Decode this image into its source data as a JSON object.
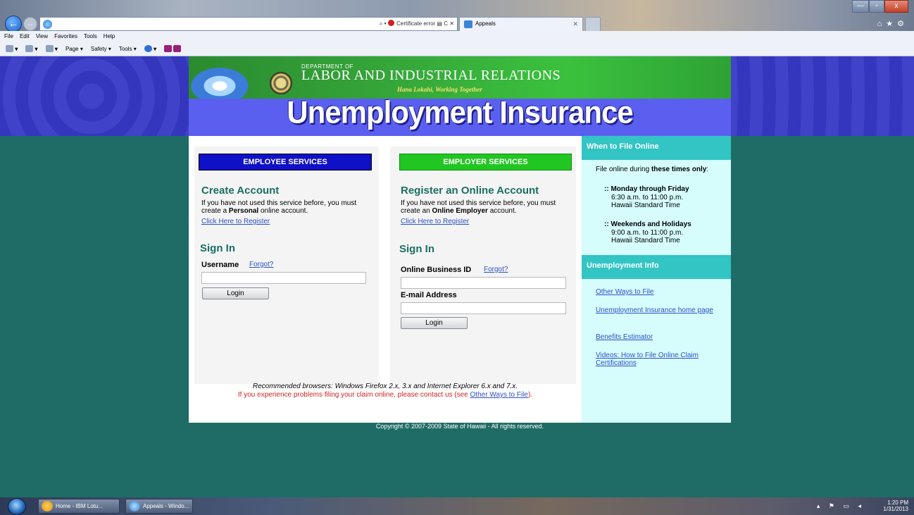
{
  "browser": {
    "address_text": "",
    "cert_error": "Certificate error",
    "addr_controls": "⌕ ▾",
    "addr_refresh": "▤ C ✕",
    "tab_title": "Appeals",
    "tab_close": "✕",
    "back_glyph": "←",
    "forward_glyph": "→",
    "min_glyph": "—",
    "max_glyph": "▫",
    "close_glyph": "x",
    "right_icons": "⌂★⚙",
    "menu": [
      "File",
      "Edit",
      "View",
      "Favorites",
      "Tools",
      "Help"
    ],
    "commands": [
      "▾",
      "▾",
      "▾",
      "Page ▾",
      "Safety ▾",
      "Tools ▾",
      "▾"
    ]
  },
  "banner": {
    "dept_small": "DEPARTMENT OF",
    "dept_name": "Labor and Industrial Relations",
    "motto": "Hana Lokahi, Working Together",
    "title": "Unemployment Insurance"
  },
  "employee": {
    "header": "EMPLOYEE SERVICES",
    "create_title": "Create Account",
    "create_text_1": "If you have not used this service before, you must create a ",
    "create_text_bold": "Personal",
    "create_text_2": " online account.",
    "register_link": "Click Here to Register",
    "signin_title": "Sign In",
    "username_label": "Username",
    "forgot_link": "Forgot?",
    "username_value": "",
    "login_label": "Login"
  },
  "employer": {
    "header": "EMPLOYER SERVICES",
    "create_title": "Register an Online Account",
    "create_text_1": "If you have not used this service before, you must create an ",
    "create_text_bold": "Online Employer",
    "create_text_2": " account.",
    "register_link": "Click Here to Register",
    "signin_title": "Sign In",
    "id_label": "Online Business ID",
    "forgot_link": "Forgot?",
    "id_value": "",
    "email_label": "E-mail Address",
    "email_value": "",
    "login_label": "Login"
  },
  "footer": {
    "browsers": "Recommended browsers: Windows Firefox 2.x, 3.x and Internet Explorer 6.x and 7.x.",
    "problems_1": "If you experience problems filing your claim online, please contact us (see ",
    "problems_link": "Other Ways to File",
    "problems_2": ").",
    "copyright": "Copyright © 2007-2009 State of Hawaii - All rights reserved."
  },
  "sidebar": {
    "when_head": "When to File Online",
    "intro_1": "File online during ",
    "intro_bold": "these times only",
    "intro_2": ":",
    "weekday_title": ":: Monday through Friday",
    "weekday_hours": "6:30 a.m. to 11:00 p.m.",
    "weekday_tz": "Hawaii Standard Time",
    "weekend_title": ":: Weekends and Holidays",
    "weekend_hours": "9:00 a.m. to 11:00 p.m.",
    "weekend_tz": "Hawaii Standard Time",
    "info_head": "Unemployment Info",
    "links": [
      "Other Ways to File",
      "Unemployment Insurance home page",
      "Benefits Estimator",
      "Videos: How to File Online Claim Certifications"
    ]
  },
  "taskbar": {
    "task_lotus": "Home - IBM Lotu...",
    "task_ie": "Appeals - Windo...",
    "tray_icons": "▴ ⚑ ▭ ◂",
    "time": "1:20 PM",
    "date": "1/31/2013"
  }
}
